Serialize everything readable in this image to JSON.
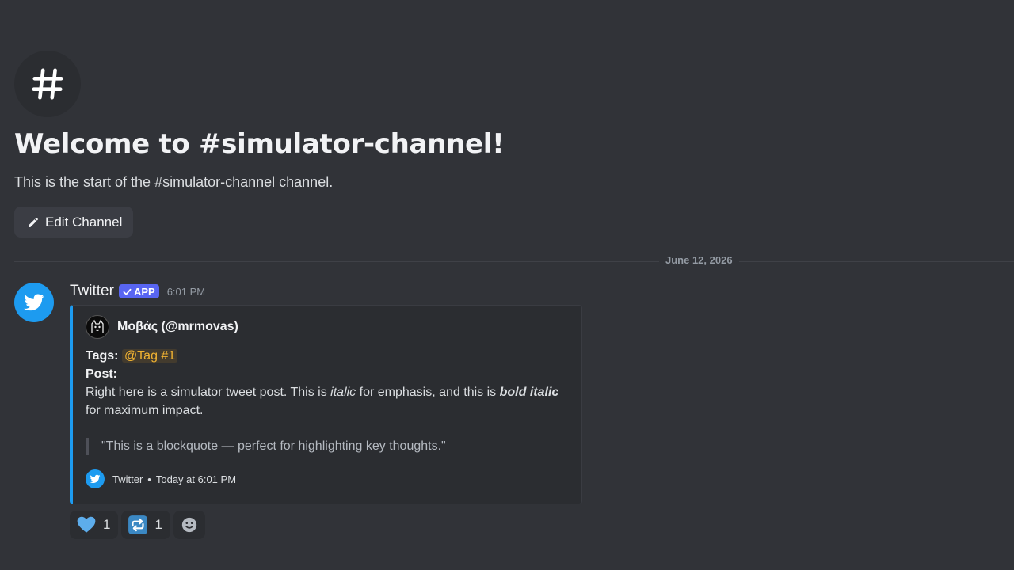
{
  "channel": {
    "hash_icon": "hash-icon",
    "welcome_title": "Welcome to #simulator-channel!",
    "welcome_subtitle": "This is the start of the #simulator-channel channel.",
    "edit_button_label": "Edit Channel",
    "edit_icon": "pencil-icon"
  },
  "divider": {
    "date": "June 12, 2026"
  },
  "message": {
    "author": "Twitter",
    "app_tag": "APP",
    "timestamp": "6:01 PM",
    "avatar_icon": "twitter-bird-icon",
    "embed": {
      "accent_color": "#1d9bf0",
      "author_name": "Μοβάς (@mrmovas)",
      "tags_label": "Tags:",
      "tag_mention": "@Tag #1",
      "post_label": "Post:",
      "post_text_1": "Right here is a simulator tweet post. This is ",
      "post_italic": "italic",
      "post_text_2": " for emphasis, and this is ",
      "post_bold_italic": "bold italic",
      "post_text_3": " for maximum impact.",
      "blockquote": "\"This is a blockquote — perfect for highlighting key thoughts.\"",
      "footer_name": "Twitter",
      "footer_separator": "•",
      "footer_time": "Today at 6:01 PM"
    },
    "reactions": [
      {
        "icon": "blue-heart-icon",
        "count": "1"
      },
      {
        "icon": "repeat-icon",
        "count": "1"
      }
    ],
    "add_reaction_icon": "smiley-icon"
  }
}
